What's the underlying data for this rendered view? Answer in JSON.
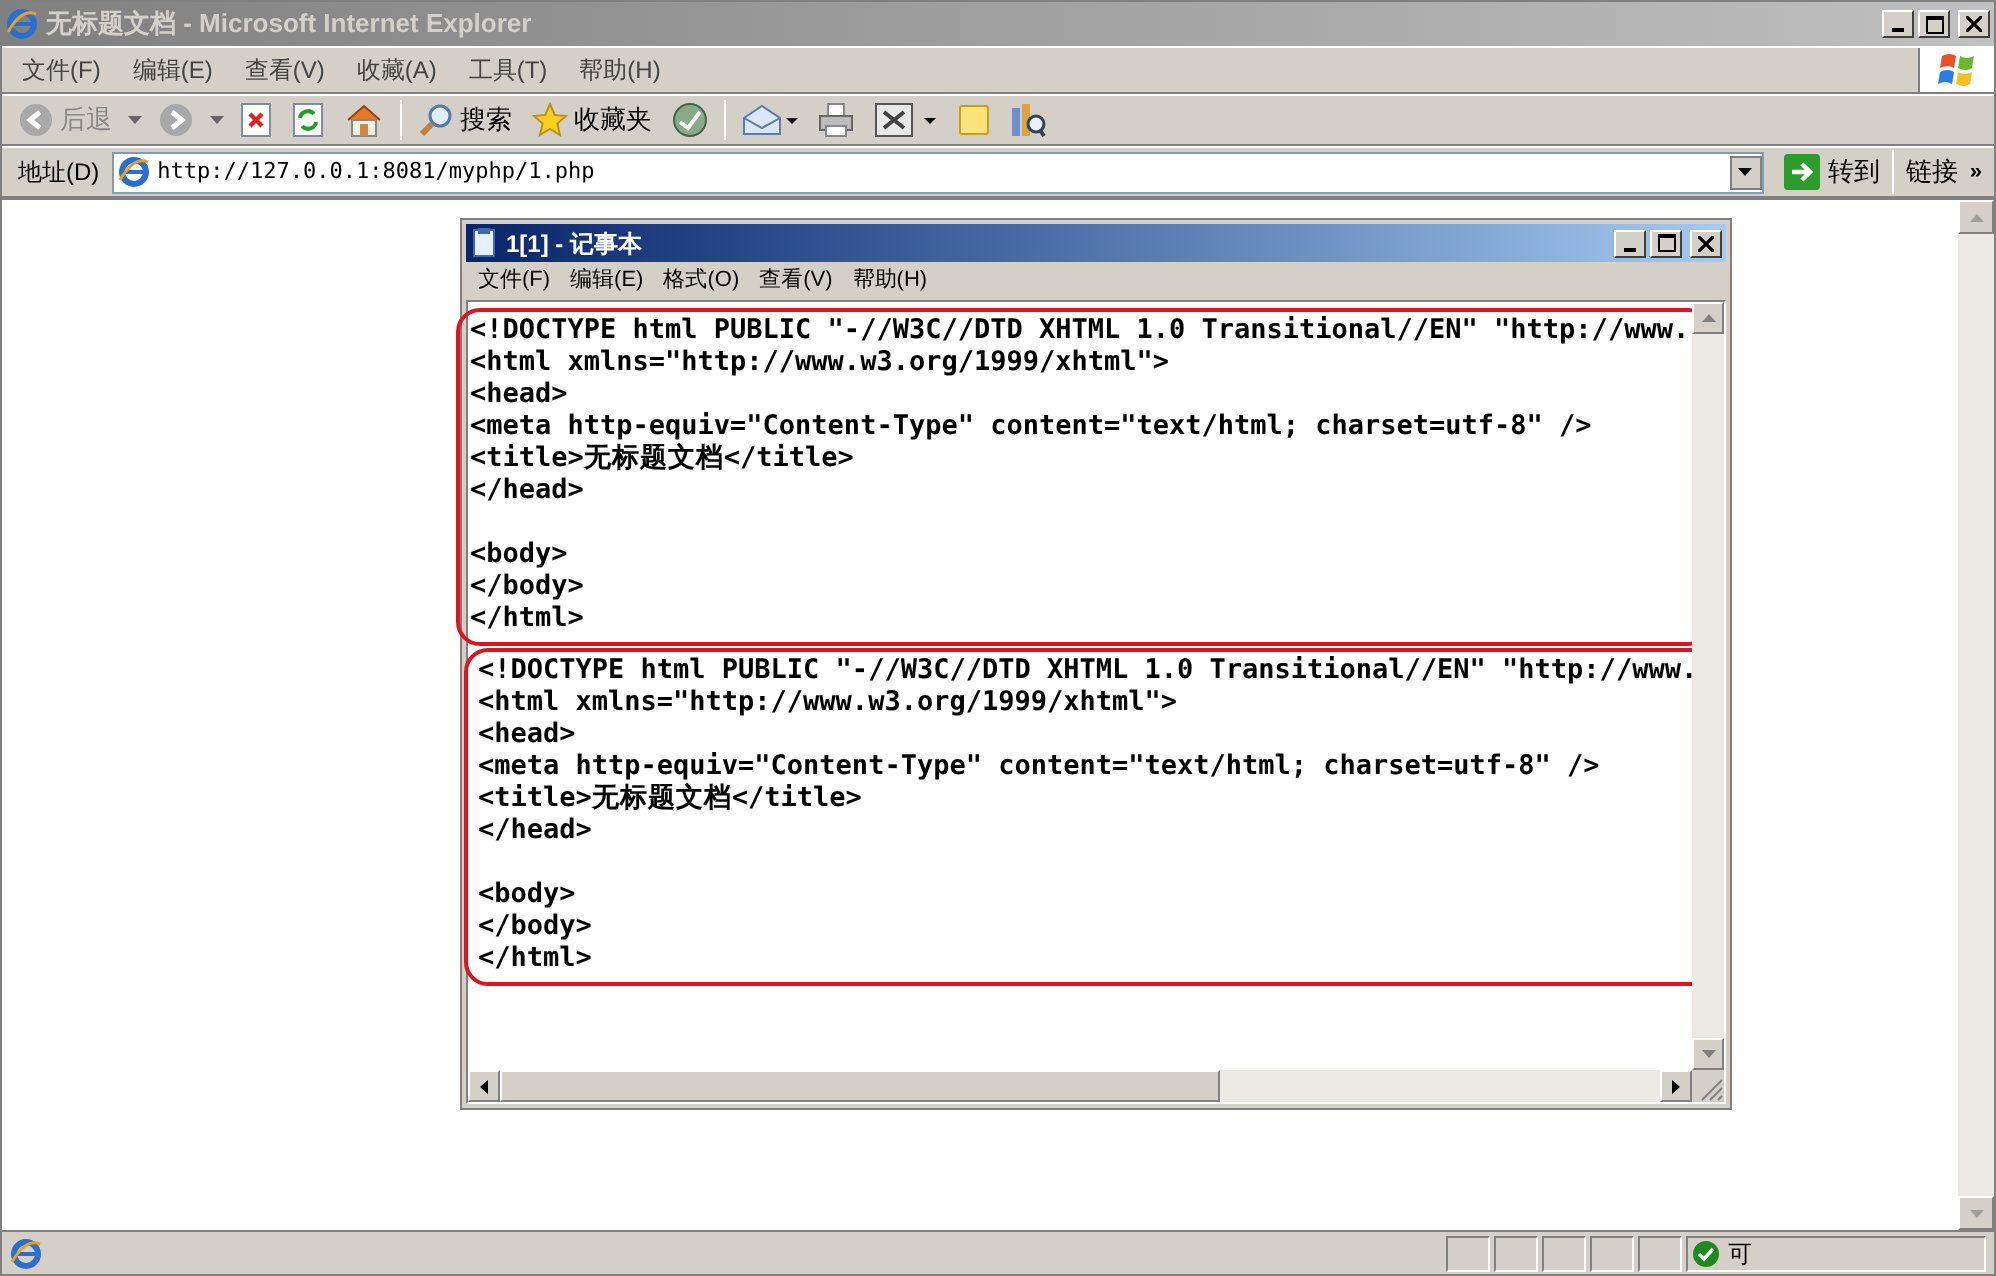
{
  "window": {
    "title": "无标题文档 - Microsoft Internet Explorer"
  },
  "menu": [
    "文件(F)",
    "编辑(E)",
    "查看(V)",
    "收藏(A)",
    "工具(T)",
    "帮助(H)"
  ],
  "toolbar": [
    {
      "kind": "back",
      "label": "后退",
      "disabled": true
    },
    {
      "kind": "forward",
      "disabled": true
    },
    {
      "kind": "stop"
    },
    {
      "kind": "refresh"
    },
    {
      "kind": "home"
    },
    {
      "kind": "search",
      "label": "搜索"
    },
    {
      "kind": "favorites",
      "label": "收藏夹"
    },
    {
      "kind": "media"
    },
    {
      "kind": "mail"
    },
    {
      "kind": "print"
    },
    {
      "kind": "edit"
    },
    {
      "kind": "note"
    },
    {
      "kind": "research"
    }
  ],
  "address_bar": {
    "label": "地址(D)",
    "value": "http://127.0.0.1:8081/myphp/1.php",
    "go_label": "转到",
    "links_label": "链接",
    "links_chevron": "»"
  },
  "notepad": {
    "title": "1[1] - 记事本",
    "menu": [
      "文件(F)",
      "编辑(E)",
      "格式(O)",
      "查看(V)",
      "帮助(H)"
    ],
    "blocks": [
      {
        "head_lines": [
          "<!DOCTYPE html PUBLIC \"-//W3C//DTD XHTML 1.0 Transitional//EN\" \"http://www.",
          "<html xmlns=\"http://www.w3.org/1999/xhtml\">",
          "<head>",
          "<meta http-equiv=\"Content-Type\" content=\"text/html; charset=utf-8\" />",
          "<title>无标题文档</title>",
          "</head>"
        ],
        "body_lines": [
          "<body>",
          "</body>",
          "</html>"
        ]
      },
      {
        "head_lines": [
          "<!DOCTYPE html PUBLIC \"-//W3C//DTD XHTML 1.0 Transitional//EN\" \"http://www.",
          "<html xmlns=\"http://www.w3.org/1999/xhtml\">",
          "<head>",
          "<meta http-equiv=\"Content-Type\" content=\"text/html; charset=utf-8\" />",
          "<title>无标题文档</title>",
          "</head>"
        ],
        "body_lines": [
          "<body>",
          "</body>",
          "</html>"
        ]
      }
    ]
  },
  "status_bar": {
    "zone": "可"
  }
}
